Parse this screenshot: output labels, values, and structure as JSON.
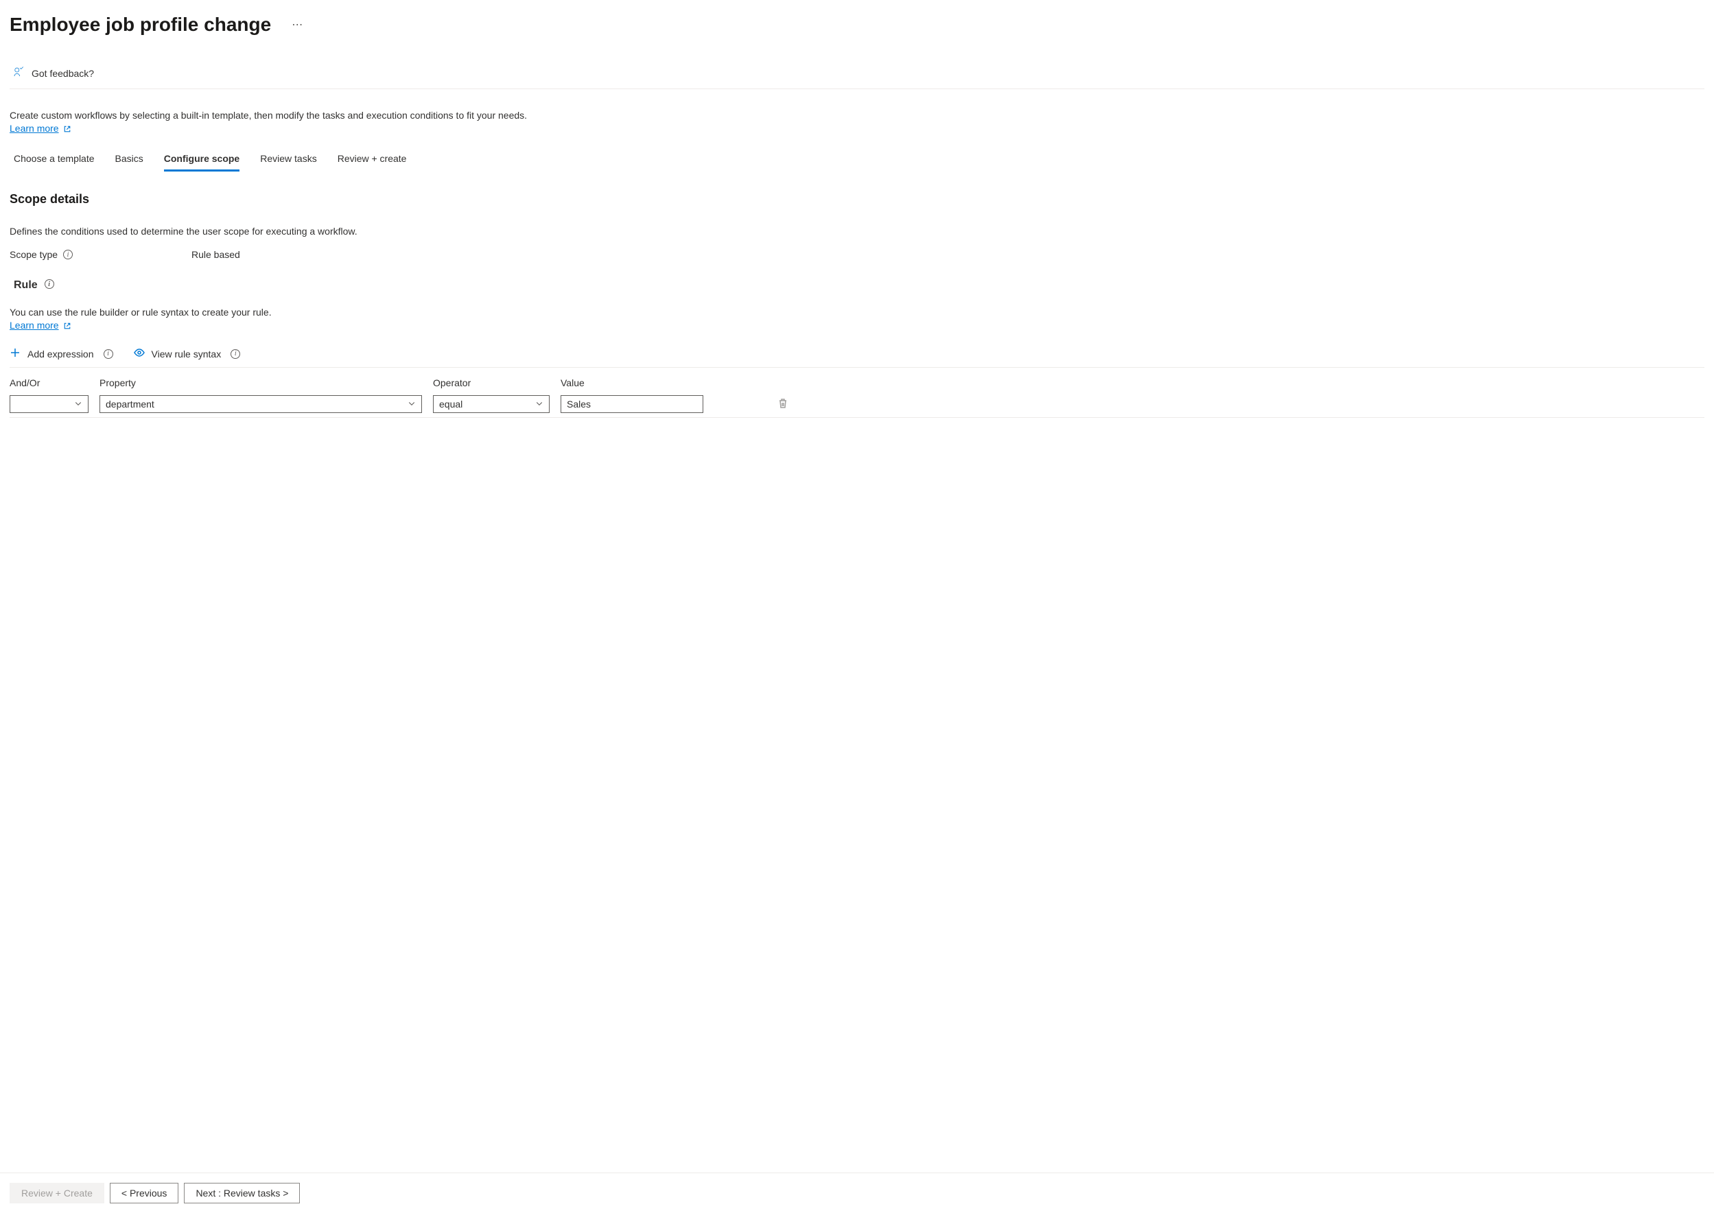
{
  "page": {
    "title": "Employee job profile change",
    "feedback_label": "Got feedback?",
    "description": "Create custom workflows by selecting a built-in template, then modify the tasks and execution conditions to fit your needs.",
    "learn_more": "Learn more"
  },
  "tabs": [
    {
      "label": "Choose a template",
      "active": false
    },
    {
      "label": "Basics",
      "active": false
    },
    {
      "label": "Configure scope",
      "active": true
    },
    {
      "label": "Review tasks",
      "active": false
    },
    {
      "label": "Review + create",
      "active": false
    }
  ],
  "scope": {
    "title": "Scope details",
    "description": "Defines the conditions used to determine the user scope for executing a workflow.",
    "type_label": "Scope type",
    "type_value": "Rule based"
  },
  "rule": {
    "heading": "Rule",
    "description": "You can use the rule builder or rule syntax to create your rule.",
    "learn_more": "Learn more",
    "add_expression": "Add expression",
    "view_syntax": "View rule syntax",
    "columns": {
      "andor": "And/Or",
      "property": "Property",
      "operator": "Operator",
      "value": "Value"
    },
    "row": {
      "andor": "",
      "property": "department",
      "operator": "equal",
      "value": "Sales"
    }
  },
  "footer": {
    "review_create": "Review + Create",
    "previous": "< Previous",
    "next": "Next : Review tasks >"
  }
}
